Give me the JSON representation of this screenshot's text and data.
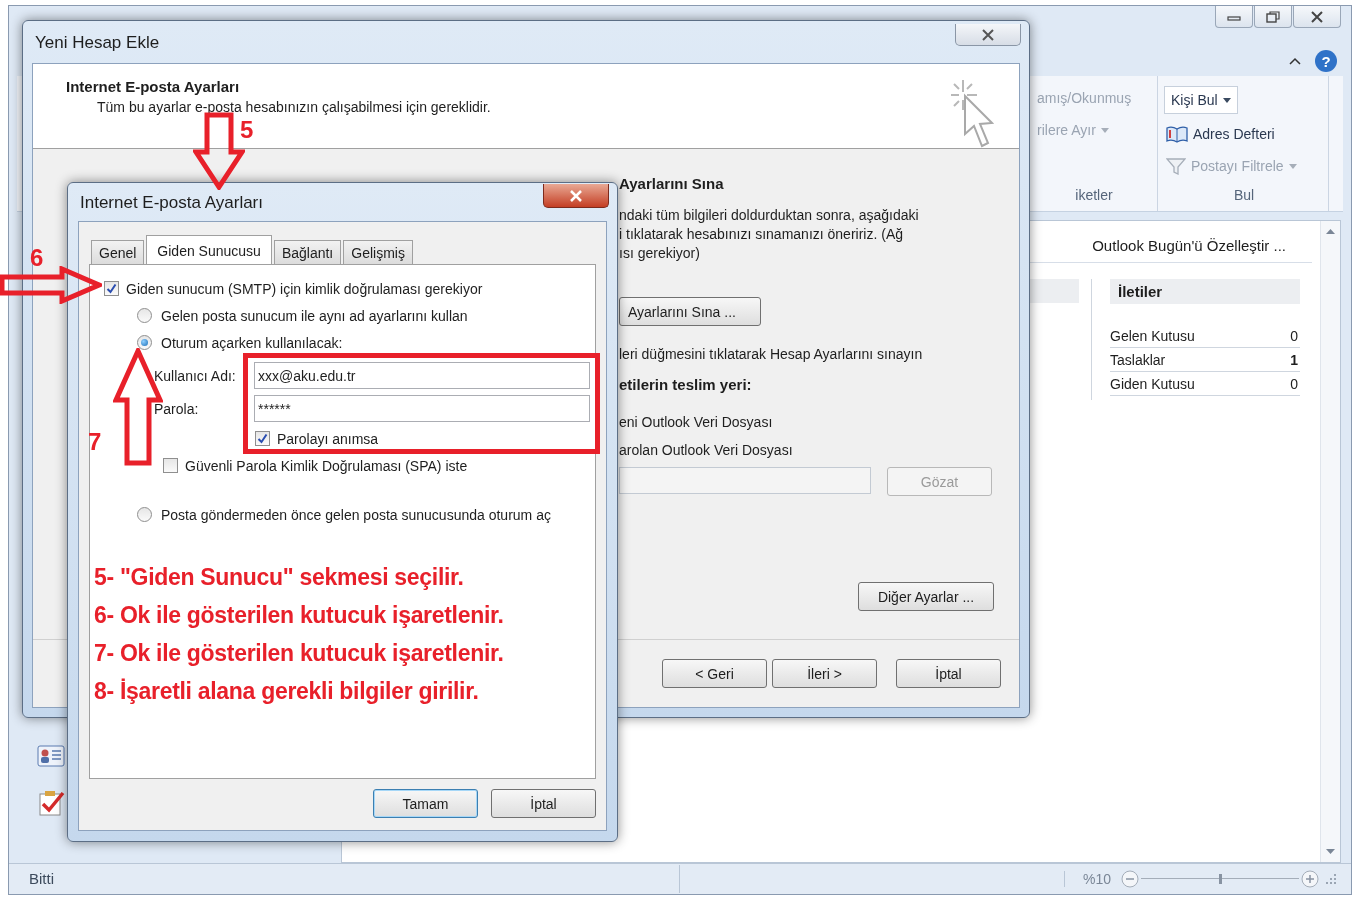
{
  "main_window": {
    "help": "?",
    "ribbon": {
      "groups": [
        {
          "label": "iketler",
          "items": [
            {
              "kind": "text",
              "label": "amış/Okunmuş",
              "disabled": true
            },
            {
              "kind": "menu",
              "label": "rilere Ayır",
              "disabled": true
            }
          ]
        },
        {
          "label": "Bul",
          "items": [
            {
              "kind": "combo",
              "label": "Kişi Bul",
              "disabled": false
            },
            {
              "kind": "book",
              "label": "Adres Defteri",
              "disabled": false
            },
            {
              "kind": "filter",
              "label": "Postayı Filtrele",
              "disabled": true
            }
          ]
        }
      ]
    },
    "today": {
      "customize_link": "Outlook Bugün'ü Özelleştir ...",
      "messages": {
        "title": "İletiler",
        "rows": [
          {
            "name": "Gelen Kutusu",
            "count": "0",
            "bold": false
          },
          {
            "name": "Taslaklar",
            "count": "1",
            "bold": true
          },
          {
            "name": "Giden Kutusu",
            "count": "0",
            "bold": false
          }
        ]
      }
    },
    "status_bar": {
      "text": "Bitti",
      "zoom": "%10",
      "zoom_slider": {
        "level": 0.5
      }
    }
  },
  "account_dialog": {
    "title": "Yeni Hesap Ekle",
    "heading": "Internet E-posta Ayarları",
    "subtitle": "Tüm bu ayarlar e-posta hesabınızın çalışabilmesi için gereklidir.",
    "test": {
      "heading": "Ayarlarını Sına",
      "text_lines": [
        "ndaki tüm bilgileri doldurduktan sonra, aşağıdaki",
        "i tıklatarak hesabınızı sınamanızı öneririz. (Ağ",
        "ısı gerekiyor)"
      ],
      "button": "Ayarlarını Sına ...",
      "hint": "leri düğmesini tıklatarak Hesap Ayarlarını sınayın"
    },
    "delivery": {
      "heading": "etilerin teslim yeri:",
      "options": [
        "eni Outlook Veri Dosyası",
        "arolan Outlook Veri Dosyası"
      ],
      "browse": {
        "label": "Gözat",
        "disabled": true
      },
      "more_button": "Diğer Ayarlar ..."
    },
    "buttons": [
      "< Geri",
      "İleri >",
      "İptal"
    ]
  },
  "settings_dialog": {
    "title": "Internet E-posta Ayarları",
    "tabs": [
      {
        "label": "Genel",
        "selected": false
      },
      {
        "label": "Giden Sunucusu",
        "selected": true
      },
      {
        "label": "Bağlantı",
        "selected": false
      },
      {
        "label": "Gelişmiş",
        "selected": false
      }
    ],
    "require_auth": {
      "label": "Giden sunucum (SMTP) için kimlik doğrulaması gerekiyor",
      "checked": true
    },
    "logon_options": [
      {
        "label": "Gelen posta sunucum ile aynı ad ayarlarını kullan",
        "selected": false
      },
      {
        "label": "Oturum açarken kullanılacak:",
        "selected": true,
        "credentials": {
          "fields": [
            {
              "label": "Kullanıcı Adı:",
              "value": "xxx@aku.edu.tr"
            },
            {
              "label": "Parola:",
              "value": "******"
            }
          ],
          "remember": {
            "label": "Parolayı anımsa",
            "checked": true
          },
          "spa": {
            "label": "Güvenli Parola Kimlik Doğrulaması (SPA) iste",
            "checked": false
          }
        }
      },
      {
        "label": "Posta göndermeden önce gelen posta sunucusunda oturum aç",
        "selected": false
      }
    ],
    "buttons": [
      "Tamam",
      "İptal"
    ]
  },
  "annotations": {
    "callouts": [
      {
        "number": "5",
        "kind": "down"
      },
      {
        "number": "6",
        "kind": "right"
      },
      {
        "number": "7",
        "kind": "up"
      }
    ],
    "steps": [
      "5- \"Giden Sunucu\" sekmesi seçilir.",
      "6- Ok ile gösterilen kutucuk işaretlenir.",
      "7- Ok ile gösterilen kutucuk işaretlenir.",
      "8- İşaretli alana gerekli bilgiler girilir."
    ]
  }
}
